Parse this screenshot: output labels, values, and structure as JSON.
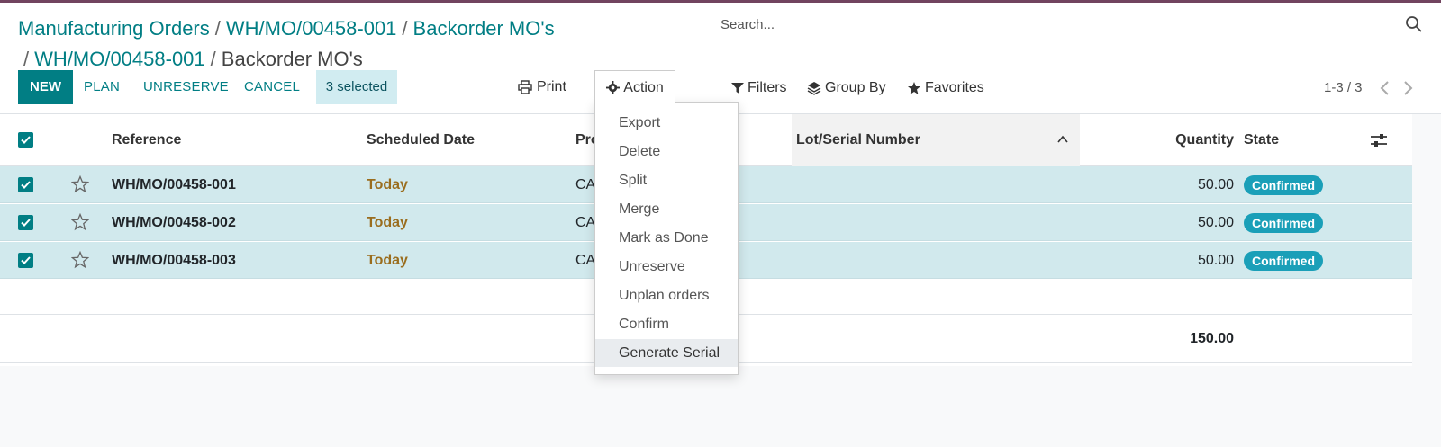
{
  "colors": {
    "brand": "#017e84",
    "topbar": "#71445f",
    "selected_row": "#d1e9ed",
    "state_badge": "#1a9fb8",
    "today": "#9a6d1e"
  },
  "breadcrumb": {
    "line1": [
      "Manufacturing Orders",
      "WH/MO/00458-001",
      "Backorder MO's"
    ],
    "line2": [
      "WH/MO/00458-001"
    ],
    "current": "Backorder MO's",
    "separator": "/"
  },
  "search": {
    "placeholder": "Search...",
    "icon": "search-icon"
  },
  "toolbar": {
    "new_label": "NEW",
    "plan_label": "PLAN",
    "unreserve_label": "UNRESERVE",
    "cancel_label": "CANCEL",
    "selected_label": "3 selected",
    "print_label": "Print",
    "action_label": "Action"
  },
  "filters": {
    "filters_label": "Filters",
    "group_by_label": "Group By",
    "favorites_label": "Favorites"
  },
  "pager": {
    "text": "1-3 / 3"
  },
  "table": {
    "columns": {
      "reference": "Reference",
      "scheduled_date": "Scheduled Date",
      "product": "Pro",
      "lot": "Lot/Serial Number",
      "quantity": "Quantity",
      "state": "State"
    },
    "rows": [
      {
        "reference": "WH/MO/00458-001",
        "date": "Today",
        "product": "CA",
        "quantity": "50.00",
        "state": "Confirmed"
      },
      {
        "reference": "WH/MO/00458-002",
        "date": "Today",
        "product": "CA",
        "quantity": "50.00",
        "state": "Confirmed"
      },
      {
        "reference": "WH/MO/00458-003",
        "date": "Today",
        "product": "CA",
        "quantity": "50.00",
        "state": "Confirmed"
      }
    ],
    "total_quantity": "150.00"
  },
  "action_menu": {
    "items": [
      "Export",
      "Delete",
      "Split",
      "Merge",
      "Mark as Done",
      "Unreserve",
      "Unplan orders",
      "Confirm",
      "Generate Serial"
    ],
    "active_item": "Generate Serial"
  }
}
